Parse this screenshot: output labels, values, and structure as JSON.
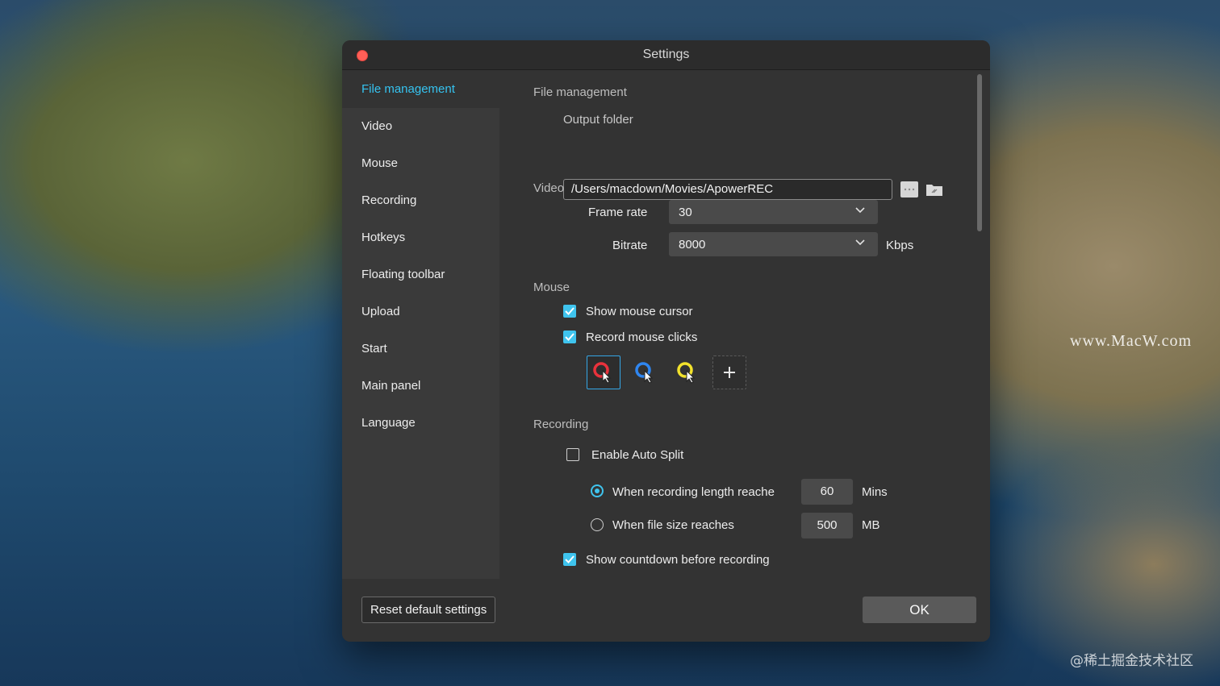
{
  "watermarks": {
    "macw": "www.MacW.com",
    "juejin": "@稀土掘金技术社区"
  },
  "window": {
    "title": "Settings"
  },
  "sidebar": {
    "items": [
      {
        "label": "File management",
        "active": true
      },
      {
        "label": "Video"
      },
      {
        "label": "Mouse"
      },
      {
        "label": "Recording"
      },
      {
        "label": "Hotkeys"
      },
      {
        "label": "Floating toolbar"
      },
      {
        "label": "Upload"
      },
      {
        "label": "Start"
      },
      {
        "label": "Main panel"
      },
      {
        "label": "Language"
      }
    ]
  },
  "file_management": {
    "section_title": "File management",
    "output_folder_label": "Output folder",
    "output_folder_path": "/Users/macdown/Movies/ApowerREC"
  },
  "video": {
    "section_title": "Video",
    "frame_rate_label": "Frame rate",
    "frame_rate_value": "30",
    "bitrate_label": "Bitrate",
    "bitrate_value": "8000",
    "bitrate_unit": "Kbps"
  },
  "mouse": {
    "section_title": "Mouse",
    "show_cursor_label": "Show mouse cursor",
    "show_cursor_checked": true,
    "record_clicks_label": "Record mouse clicks",
    "record_clicks_checked": true,
    "click_styles": [
      {
        "icon": "red-ring-cursor-icon",
        "color": "#e8323c",
        "selected": true
      },
      {
        "icon": "blue-ring-cursor-icon",
        "color": "#2f86f0"
      },
      {
        "icon": "yellow-ring-cursor-icon",
        "color": "#f2e22c"
      }
    ],
    "add_style_icon": "plus-icon"
  },
  "recording": {
    "section_title": "Recording",
    "auto_split_label": "Enable Auto Split",
    "auto_split_checked": false,
    "length_option_label": "When recording length reache",
    "length_value": "60",
    "length_unit": "Mins",
    "size_option_label": "When file size reaches",
    "size_value": "500",
    "size_unit": "MB",
    "countdown_label": "Show countdown before recording",
    "countdown_checked": true
  },
  "footer": {
    "reset_label": "Reset default settings",
    "ok_label": "OK"
  },
  "colors": {
    "accent": "#3fc4ee",
    "close": "#ff5f57"
  }
}
